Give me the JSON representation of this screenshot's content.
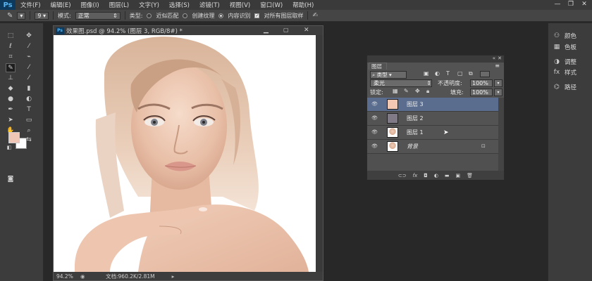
{
  "app": {
    "logo": "Ps"
  },
  "menu": [
    "文件(F)",
    "编辑(E)",
    "图像(I)",
    "图层(L)",
    "文字(Y)",
    "选择(S)",
    "滤镜(T)",
    "视图(V)",
    "窗口(W)",
    "帮助(H)"
  ],
  "window_controls": {
    "minimize": "—",
    "restore": "❐",
    "close": "✕"
  },
  "options": {
    "brush_size": "9",
    "mode_label": "模式:",
    "mode_value": "正常",
    "type_label": "类型:",
    "type_options": [
      "近似匹配",
      "创建纹理",
      "内容识别"
    ],
    "type_selected_index": 2,
    "sample_all_label": "对所有图层取样",
    "sample_all_checked": true
  },
  "colors": {
    "foreground": "#f0c6b6",
    "background": "#ffffff",
    "layer3_fill": "#f2c8b3",
    "layer2_fill": "#7f7a86",
    "selection": "#5a6d8e"
  },
  "document": {
    "title": "效果图.psd @ 94.2% (图层 3, RGB/8#) *",
    "zoom": "94.2%",
    "status": "文档:960.2K/2.81M"
  },
  "layers_panel": {
    "tab": "图层",
    "filter": "类型",
    "blend_mode": "柔光",
    "opacity_label": "不透明度:",
    "opacity": "100%",
    "lock_label": "锁定:",
    "fill_label": "填充:",
    "fill": "100%",
    "layers": [
      {
        "name": "图层 3",
        "selected": true,
        "thumb": "color-swatch"
      },
      {
        "name": "图层 2",
        "selected": false,
        "thumb": "color-swatch"
      },
      {
        "name": "图层 1",
        "selected": false,
        "thumb": "portrait"
      },
      {
        "name": "背景",
        "selected": false,
        "thumb": "portrait",
        "locked": true
      }
    ],
    "footer_icons": [
      "link-icon",
      "fx-icon",
      "mask-icon",
      "adjustment-icon",
      "group-icon",
      "new-layer-icon",
      "trash-icon"
    ]
  },
  "dock": [
    {
      "label": "颜色",
      "icon": "palette-icon"
    },
    {
      "label": "色板",
      "icon": "swatches-icon"
    },
    {
      "label": "调整",
      "icon": "adjust-icon"
    },
    {
      "label": "样式",
      "icon": "styles-icon"
    },
    {
      "label": "路径",
      "icon": "paths-icon"
    }
  ]
}
